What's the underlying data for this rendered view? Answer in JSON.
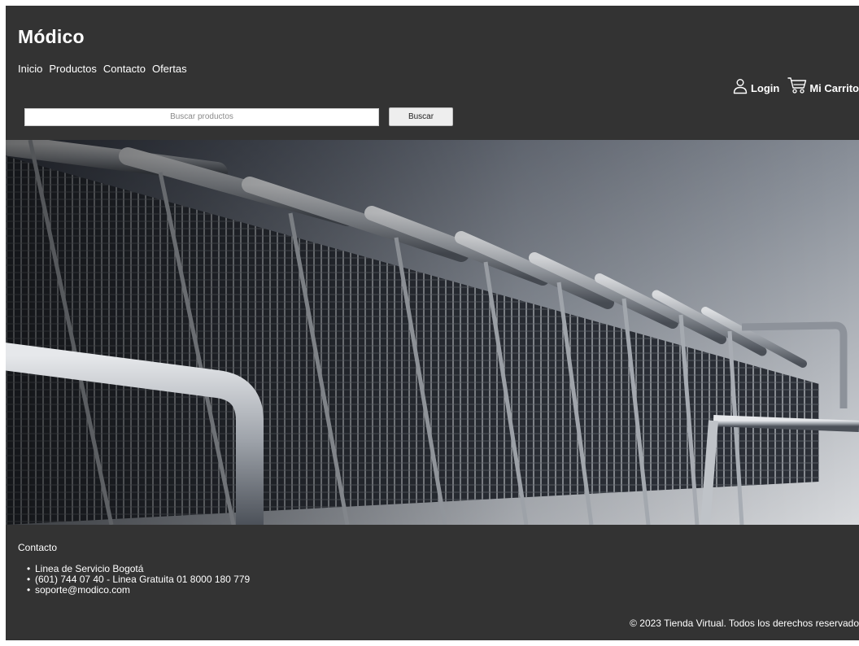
{
  "header": {
    "brand": "Módico",
    "nav": [
      {
        "label": "Inicio"
      },
      {
        "label": "Productos"
      },
      {
        "label": "Contacto"
      },
      {
        "label": "Ofertas"
      }
    ],
    "login_label": "Login",
    "cart_label": "Mi Carrito"
  },
  "search": {
    "placeholder": "Buscar productos",
    "value": "",
    "button_label": "Buscar"
  },
  "hero": {
    "icon": "shopping-carts-photo"
  },
  "footer": {
    "title": "Contacto",
    "items": [
      "Linea de Servicio Bogotá",
      "(601) 744 07 40 - Linea Gratuita 01 8000 180 779",
      "soporte@modico.com"
    ],
    "copyright": "© 2023 Tienda Virtual. Todos los derechos reservado"
  },
  "colors": {
    "background": "#333333",
    "text": "#ffffff"
  }
}
